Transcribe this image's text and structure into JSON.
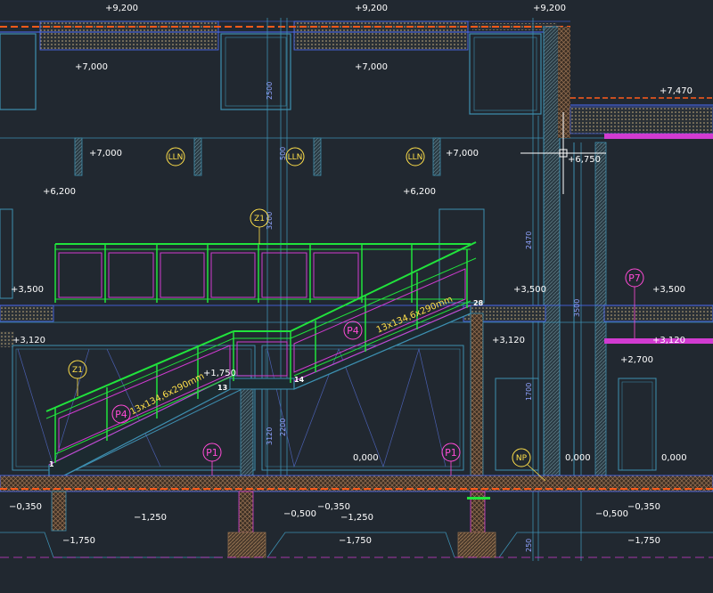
{
  "drawing": {
    "colors": {
      "background": "#212830",
      "wall": "#3d8fb0",
      "level": "#4d6eff",
      "rail": "#21e33c",
      "glass": "#d13bd1",
      "orange": "#ff5a1a",
      "hatch": "#8a6a4a",
      "tag_yellow": "#ffe04a",
      "tag_magenta": "#ff4bd6",
      "text": "#ffffff"
    },
    "levels": {
      "l920_a": "+9,200",
      "l920_b": "+9,200",
      "l920_c": "+9,200",
      "l700_a": "+7,000",
      "l700_b": "+7,000",
      "l700_c": "+7,000",
      "l700_d": "+7,000",
      "l747": "+7,470",
      "l675": "+6,750",
      "l620_a": "+6,200",
      "l620_b": "+6,200",
      "l350_a": "+3,500",
      "l350_b": "+3,500",
      "l350_c": "+3,500",
      "l312_a": "+3,120",
      "l312_b": "+3,120",
      "l312_c": "+3,120",
      "l270": "+2,700",
      "l000_a": "0,000",
      "l000_b": "0,000",
      "l000_c": "0,000",
      "lm035_a": "−0,350",
      "lm035_b": "−0,350",
      "lm035_c": "−0,350",
      "lm050_a": "−0,500",
      "lm050_b": "−0,500",
      "lm125_a": "−1,250",
      "lm125_b": "−1,250",
      "lm175_a": "−1,750",
      "lm175_b": "−1,750",
      "lm175_c": "−1,750",
      "l1750_mid": "+1,750"
    },
    "dims": {
      "d1": "2500",
      "d2": "3200",
      "d3": "3120",
      "d4": "500",
      "d5": "2200",
      "d6": "1700",
      "d7": "2470",
      "d8": "3500",
      "d9": "250"
    },
    "tags": {
      "lln1": "LLN",
      "lln2": "LLN",
      "lln3": "LLN",
      "z1_top": "Z1",
      "z1_left": "Z1",
      "p7": "P7",
      "p4_a": "P4",
      "p4_b": "P4",
      "p1_a": "P1",
      "p1_b": "P1",
      "np": "NP"
    },
    "stair_notes": {
      "upper": "13x134,6x290mm",
      "lower": "13x134,6x290mm"
    },
    "step_numbers": {
      "s1": "1",
      "s13": "13",
      "s14": "14",
      "s28": "28"
    }
  }
}
